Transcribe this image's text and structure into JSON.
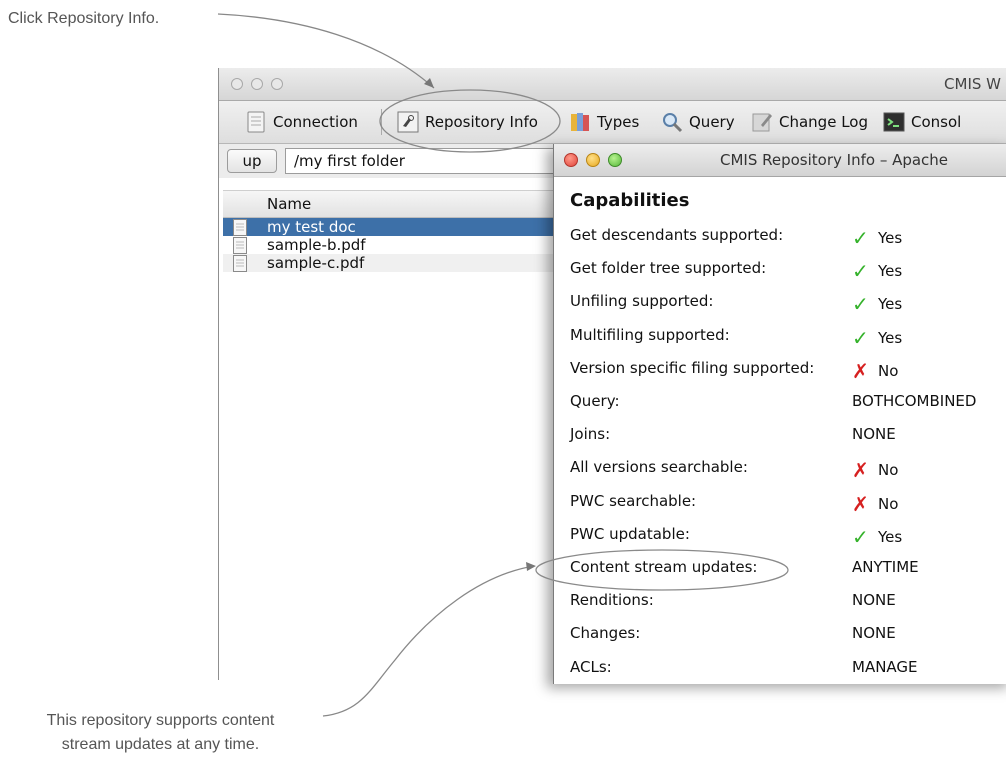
{
  "callouts": {
    "top": "Click Repository Info.",
    "bottom_line1": "This repository supports content",
    "bottom_line2": "stream updates at any time."
  },
  "main_window": {
    "title": "CMIS W",
    "toolbar": [
      {
        "label": "Connection",
        "icon": "connection-icon"
      },
      {
        "label": "Repository Info",
        "icon": "repository-info-icon"
      },
      {
        "label": "Types",
        "icon": "types-icon"
      },
      {
        "label": "Query",
        "icon": "query-icon"
      },
      {
        "label": "Change Log",
        "icon": "change-log-icon"
      },
      {
        "label": "Consol",
        "icon": "console-icon"
      }
    ],
    "up_label": "up",
    "path": "/my first folder",
    "column_name": "Name",
    "files": [
      "my test doc",
      "sample-b.pdf",
      "sample-c.pdf"
    ]
  },
  "dialog": {
    "title": "CMIS Repository Info – Apache",
    "section": "Capabilities",
    "rows": [
      {
        "label": "Get descendants supported:",
        "value": "Yes",
        "status": "yes"
      },
      {
        "label": "Get folder tree supported:",
        "value": "Yes",
        "status": "yes"
      },
      {
        "label": "Unfiling supported:",
        "value": "Yes",
        "status": "yes"
      },
      {
        "label": "Multifiling supported:",
        "value": "Yes",
        "status": "yes"
      },
      {
        "label": "Version specific filing supported:",
        "value": "No",
        "status": "no"
      },
      {
        "label": "Query:",
        "value": "BOTHCOMBINED",
        "status": "none"
      },
      {
        "label": "Joins:",
        "value": "NONE",
        "status": "none"
      },
      {
        "label": "All versions searchable:",
        "value": "No",
        "status": "no"
      },
      {
        "label": "PWC searchable:",
        "value": "No",
        "status": "no"
      },
      {
        "label": "PWC updatable:",
        "value": "Yes",
        "status": "yes"
      },
      {
        "label": "Content stream updates:",
        "value": "ANYTIME",
        "status": "none"
      },
      {
        "label": "Renditions:",
        "value": "NONE",
        "status": "none"
      },
      {
        "label": "Changes:",
        "value": "NONE",
        "status": "none"
      },
      {
        "label": "ACLs:",
        "value": "MANAGE",
        "status": "none"
      }
    ]
  },
  "colors": {
    "selection": "#3d70a8",
    "check": "#35b22b",
    "cross": "#d62020"
  }
}
